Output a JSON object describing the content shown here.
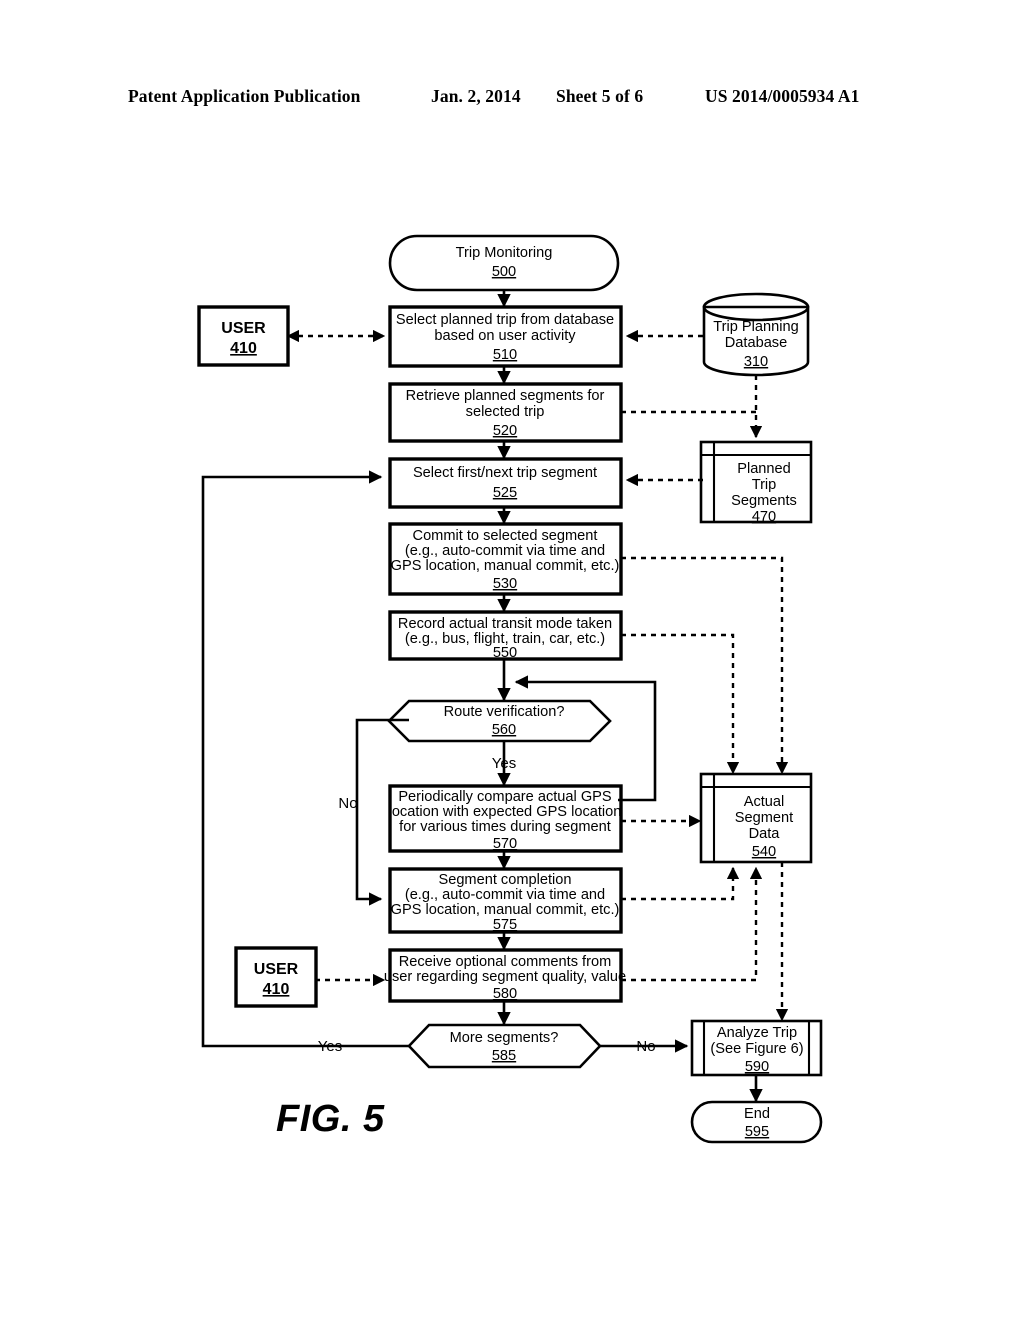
{
  "header": {
    "publication": "Patent Application Publication",
    "date": "Jan. 2, 2014",
    "sheet": "Sheet 5 of 6",
    "number": "US 2014/0005934 A1"
  },
  "figure": {
    "label": "FIG. 5",
    "title": "Trip Monitoring flowchart"
  },
  "nodes": {
    "start": {
      "text": "Trip Monitoring",
      "ref": "500",
      "shape": "terminator"
    },
    "user_top": {
      "text": "USER",
      "ref": "410",
      "shape": "entity"
    },
    "select_trip": {
      "line1": "Select planned trip from database",
      "line2": "based on user activity",
      "ref": "510",
      "shape": "process"
    },
    "trip_planning_db": {
      "line1": "Trip Planning",
      "line2": "Database",
      "ref": "310",
      "shape": "database"
    },
    "retrieve_segments": {
      "line1": "Retrieve planned segments for",
      "line2": "selected trip",
      "ref": "520",
      "shape": "process"
    },
    "select_segment": {
      "line1": "Select first/next trip segment",
      "ref": "525",
      "shape": "process"
    },
    "planned_trip_segments": {
      "line1": "Planned",
      "line2": "Trip",
      "line3": "Segments",
      "ref": "470",
      "shape": "datastore"
    },
    "commit_segment": {
      "line1": "Commit to selected segment",
      "line2": "(e.g., auto-commit via time and",
      "line3": "GPS location, manual commit, etc.)",
      "ref": "530",
      "shape": "process"
    },
    "record_mode": {
      "line1": "Record actual transit mode taken",
      "line2": "(e.g., bus, flight, train, car, etc.)",
      "ref": "550",
      "shape": "process"
    },
    "route_verification": {
      "line1": "Route verification?",
      "ref": "560",
      "shape": "decision"
    },
    "compare_gps": {
      "line1": "Periodically compare actual GPS",
      "line2": "location with expected GPS location",
      "line3": "for various times during segment",
      "ref": "570",
      "shape": "process"
    },
    "segment_completion": {
      "line1": "Segment completion",
      "line2": "(e.g., auto-commit via time and",
      "line3": "GPS location, manual commit, etc.)",
      "ref": "575",
      "shape": "process"
    },
    "actual_segment_data": {
      "line1": "Actual",
      "line2": "Segment",
      "line3": "Data",
      "ref": "540",
      "shape": "datastore"
    },
    "user_bottom": {
      "text": "USER",
      "ref": "410",
      "shape": "entity"
    },
    "receive_comments": {
      "line1": "Receive optional comments from",
      "line2": "user regarding segment quality, value",
      "ref": "580",
      "shape": "process"
    },
    "more_segments": {
      "line1": "More segments?",
      "ref": "585",
      "shape": "decision"
    },
    "analyze_trip": {
      "line1": "Analyze Trip",
      "line2": "(See Figure 6)",
      "ref": "590",
      "shape": "predefined"
    },
    "end": {
      "text": "End",
      "ref": "595",
      "shape": "terminator"
    }
  },
  "edge_labels": {
    "route_yes": "Yes",
    "route_no": "No",
    "more_yes": "Yes",
    "more_no": "No"
  },
  "colors": {
    "ink": "#000000",
    "paper": "#ffffff"
  }
}
